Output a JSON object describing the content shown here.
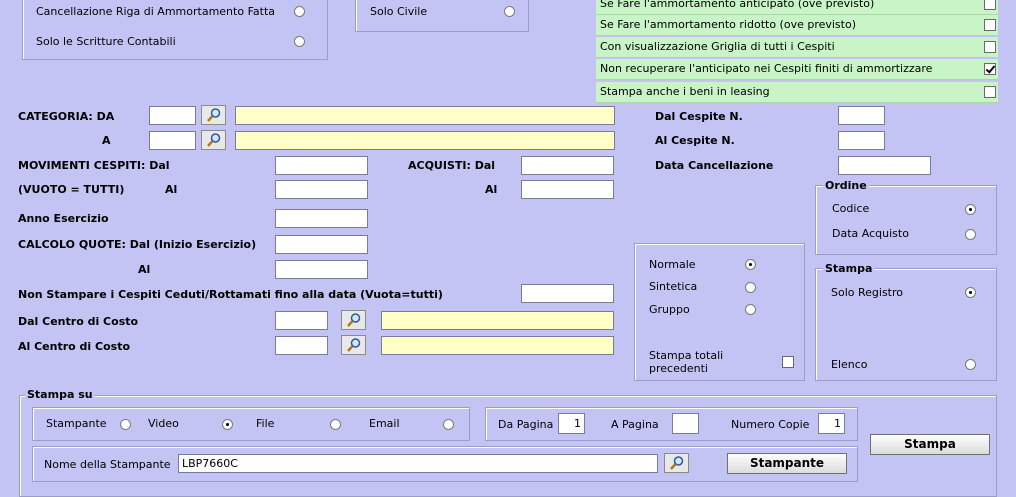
{
  "top_left": {
    "opt1": "Cancellazione Riga di Ammortamento Fatta",
    "opt2": "Solo le Scritture Contabili"
  },
  "top_mid": {
    "opt1": "Solo Civile"
  },
  "options": [
    {
      "label": "Se Fare l'ammortamento anticipato (ove previsto)",
      "checked": false
    },
    {
      "label": "Se Fare l'ammortamento ridotto (ove previsto)",
      "checked": false
    },
    {
      "label": "Con visualizzazione Griglia di tutti i Cespiti",
      "checked": false
    },
    {
      "label": "Non recuperare l'anticipato nei Cespiti finiti di ammortizzare",
      "checked": true
    },
    {
      "label": "Stampa anche i beni in leasing",
      "checked": false
    }
  ],
  "labels": {
    "categoria_da": "CATEGORIA: DA",
    "categoria_a": "A",
    "mov_dal": "MOVIMENTI CESPITI: Dal",
    "vuoto": "(VUOTO =  TUTTI)",
    "mov_al": "Al",
    "acquisti_dal": "ACQUISTI: Dal",
    "acquisti_al": "Al",
    "anno": "Anno Esercizio",
    "calcolo": "CALCOLO QUOTE: Dal (Inizio Esercizio)",
    "calcolo_al": "Al",
    "non_stampare": "Non Stampare i Cespiti Ceduti/Rottamati fino alla data (Vuota=tutti)",
    "dal_centro": "Dal Centro di Costo",
    "al_centro": "Al Centro di Costo",
    "dal_cespite": "Dal Cespite N.",
    "al_cespite": "Al Cespite N.",
    "data_canc": "Data Cancellazione"
  },
  "ordine": {
    "title": "Ordine",
    "codice": "Codice",
    "data_acquisto": "Data Acquisto"
  },
  "tipo": {
    "normale": "Normale",
    "sintetica": "Sintetica",
    "gruppo": "Gruppo",
    "totali1": "Stampa totali",
    "totali2": "precedenti"
  },
  "stampa_box": {
    "title": "Stampa",
    "solo_registro": "Solo Registro",
    "elenco": "Elenco"
  },
  "stampa_su": {
    "title": "Stampa su",
    "stampante": "Stampante",
    "video": "Video",
    "file": "File",
    "email": "Email",
    "da_pagina": "Da Pagina",
    "da_pagina_val": "1",
    "a_pagina": "A Pagina",
    "a_pagina_val": "",
    "numero_copie": "Numero Copie",
    "numero_copie_val": "1",
    "nome_stampante": "Nome della Stampante",
    "nome_stampante_val": "LBP7660C",
    "btn_stampa": "Stampa",
    "btn_stampante": "Stampante"
  }
}
